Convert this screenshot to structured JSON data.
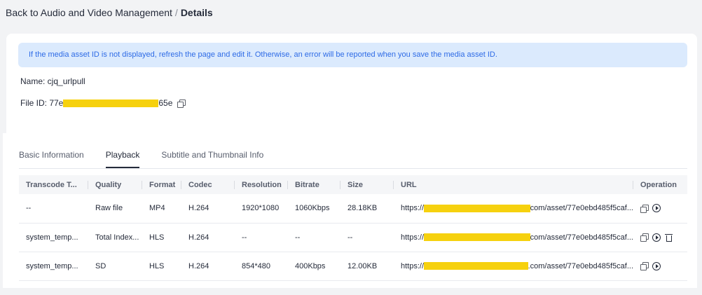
{
  "breadcrumb": {
    "back": "Back to Audio and Video Management",
    "separator": "/",
    "current": "Details"
  },
  "notice": "If the media asset ID is not displayed, refresh the page and edit it. Otherwise, an error will be reported when you save the media asset ID.",
  "name": {
    "label": "Name: cjq_urlpull"
  },
  "file_id": {
    "prefix": "File ID: 77e",
    "suffix": "65e"
  },
  "tabs": [
    {
      "label": "Basic Information",
      "active": false
    },
    {
      "label": "Playback",
      "active": true
    },
    {
      "label": "Subtitle and Thumbnail Info",
      "active": false
    }
  ],
  "table": {
    "headers": [
      "Transcode T...",
      "Quality",
      "Format",
      "Codec",
      "Resolution",
      "Bitrate",
      "Size",
      "URL",
      "Operation"
    ],
    "rows": [
      {
        "transcode": "--",
        "quality": "Raw file",
        "format": "MP4",
        "codec": "H.264",
        "resolution": "1920*1080",
        "bitrate": "1060Kbps",
        "size": "28.18KB",
        "url_prefix": "https://",
        "url_suffix": "com/asset/77e0ebd485f5caf..."
      },
      {
        "transcode": "system_temp...",
        "quality": "Total Index...",
        "format": "HLS",
        "codec": "H.264",
        "resolution": "--",
        "bitrate": "--",
        "size": "--",
        "url_prefix": "https://",
        "url_suffix": "com/asset/77e0ebd485f5caf..."
      },
      {
        "transcode": "system_temp...",
        "quality": "SD",
        "format": "HLS",
        "codec": "H.264",
        "resolution": "854*480",
        "bitrate": "400Kbps",
        "size": "12.00KB",
        "url_prefix": "https://",
        "url_suffix": ".com/asset/77e0ebd485f5caf..."
      }
    ]
  },
  "colors": {
    "notice_bg": "#dbeafd",
    "notice_text": "#2e6be6",
    "redaction": "#f6d10e",
    "page_bg": "#f2f3f5"
  },
  "icons": [
    "copy-icon",
    "play-icon",
    "delete-icon"
  ]
}
